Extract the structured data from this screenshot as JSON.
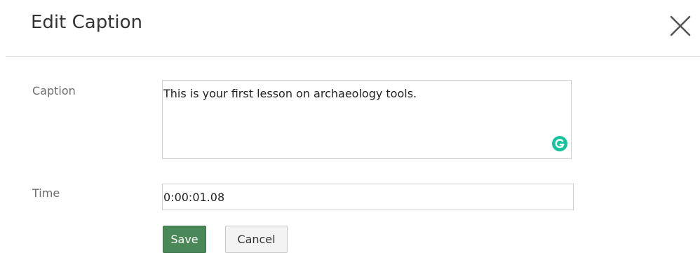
{
  "dialog": {
    "title": "Edit Caption",
    "close_icon": "close-icon"
  },
  "form": {
    "caption_label": "Caption",
    "caption_value": "This is your first lesson on archaeology tools.",
    "grammarly_icon": "grammarly-icon",
    "time_label": "Time",
    "time_value": "0:00:01.08"
  },
  "actions": {
    "save_label": "Save",
    "cancel_label": "Cancel"
  },
  "colors": {
    "save_button": "#4a8858",
    "grammarly": "#15c39a",
    "divider": "#e2e2e2"
  }
}
